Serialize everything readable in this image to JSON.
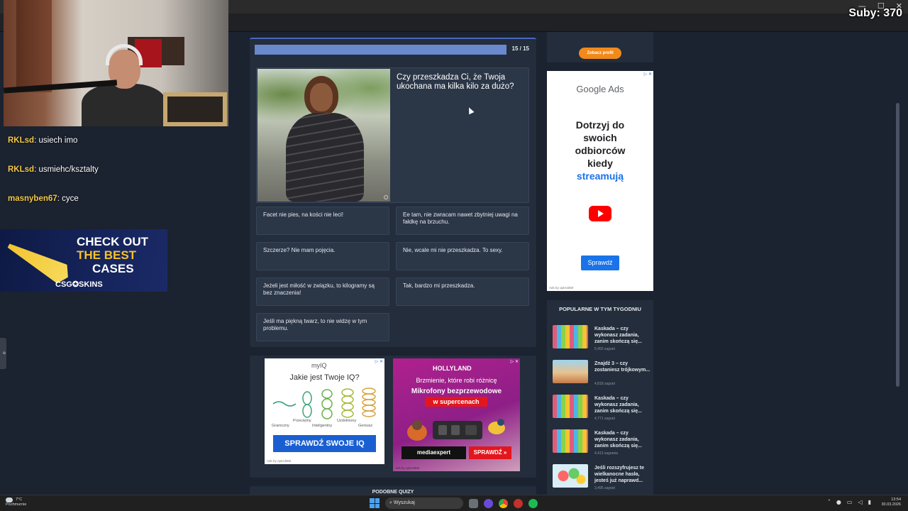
{
  "stream": {
    "subs_label": "Suby: 370",
    "chat": [
      {
        "user": "RKLsd",
        "message": "usiech imo"
      },
      {
        "user": "RKLsd",
        "message": "usmiehc/ksztalty"
      },
      {
        "user": "masnyben67",
        "message": "cyce"
      }
    ],
    "banner": {
      "line1": "CHECK OUT",
      "line2": "THE BEST",
      "line3": "CASES",
      "brand": "CSG✪SKINS"
    }
  },
  "browser": {
    "window_controls": [
      "—",
      "☐",
      "✕"
    ],
    "toolbar_icons": [
      "⇩",
      "☆",
      "⧉",
      "▮",
      "⋮"
    ]
  },
  "quiz": {
    "progress": {
      "current": 15,
      "total": 15,
      "fraction": 1.0,
      "label": "15 / 15"
    },
    "question": "Czy przeszkadza Ci, że Twoja ukochana ma kilka kilo za dużo?",
    "answers": [
      "Facet nie pies, na kości nie leci!",
      "Ee tam, nie zwracam nawet zbytniej uwagi na fałdkę na brzuchu.",
      "Szczerze? Nie mam pojęcia.",
      "Nie, wcale mi nie przeszkadza. To sexy.",
      "Jeżeli jest miłość w związku, to kilogramy są bez znaczenia!",
      "Tak, bardzo mi przeszkadza.",
      "Jeśli ma piękną twarz, to nie widzę w tym problemu."
    ],
    "similar_title": "PODOBNE QUIZY"
  },
  "ads": {
    "iq": {
      "logo": "myIQ",
      "title": "Jakie jest Twoje IQ?",
      "labels": [
        "Graniczny",
        "Przeciętny",
        "Inteligentny",
        "Uzdolniony",
        "Geniusz"
      ],
      "button": "SPRAWDŹ SWOJE IQ",
      "footer": "Ads by optAd360"
    },
    "hollyland": {
      "logo": "HOLLYLAND",
      "line1": "Brzmienie, które robi różnicę",
      "line2": "Mikrofony bezprzewodowe",
      "line3": "w supercenach",
      "store": "mediaexpert",
      "button": "SPRAWDŹ »",
      "footer": "Ads by optAd360"
    },
    "google": {
      "logo": "Google Ads",
      "text_lines": [
        "Dotrzyj do",
        "swoich",
        "odbiorców",
        "kiedy"
      ],
      "accent": "streamują",
      "button": "Sprawdź",
      "footer": "Ads by optAd360"
    }
  },
  "sidebar": {
    "profile_button": "Zobacz profil",
    "popular_title": "POPULARNE W TYM TYGODNIU",
    "popular": [
      {
        "title": "Kaskada – czy wykonasz zadania, zanim skończą się...",
        "count": "5,450 zagrań"
      },
      {
        "title": "Znajdź 3 – czy zostaniesz trójkowym...",
        "count": "4,818 zagrań"
      },
      {
        "title": "Kaskada – czy wykonasz zadania, zanim skończą się...",
        "count": "4,771 zagrań"
      },
      {
        "title": "Kaskada – czy wykonasz zadania, zanim skończą się...",
        "count": "4,413 zagrania"
      },
      {
        "title": "Jeśli rozszyfrujesz te wielkanocne hasła, jesteś już naprawd...",
        "count": "3,495 zagrań"
      }
    ]
  },
  "taskbar": {
    "weather_temp": "7°C",
    "weather_desc": "Pochmurnie",
    "search_placeholder": "Wyszukaj",
    "time": "13:54",
    "date": "30.03.2026"
  },
  "colors": {
    "accent": "#4a67c0",
    "progress": "#6a88cc",
    "card": "#232d3b",
    "page_bg": "#1b2230",
    "username": "#f2c94c",
    "orange": "#f08a1c"
  }
}
